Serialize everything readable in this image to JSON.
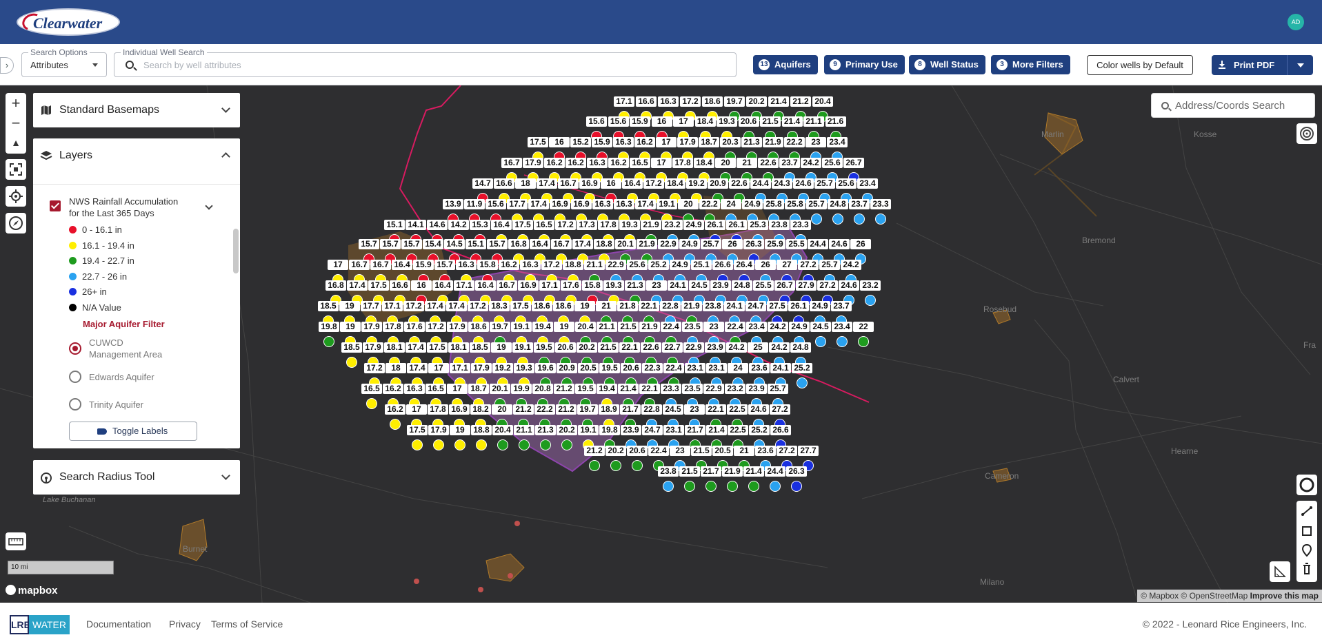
{
  "header": {
    "logo_text": "Clearwater",
    "avatar_initials": "AD"
  },
  "search": {
    "options_legend": "Search Options",
    "options_value": "Attributes",
    "well_legend": "Individual Well Search",
    "well_placeholder": "Search by well attributes"
  },
  "filters": [
    {
      "count": "13",
      "label": "Aquifers"
    },
    {
      "count": "9",
      "label": "Primary Use"
    },
    {
      "count": "8",
      "label": "Well Status"
    },
    {
      "count": "3",
      "label": "More Filters"
    }
  ],
  "actions": {
    "color_wells": "Color wells by Default",
    "print_pdf": "Print PDF"
  },
  "panel": {
    "basemaps_title": "Standard Basemaps",
    "layers_title": "Layers",
    "layer_name_line1": "NWS Rainfall Accumulation",
    "layer_name_line2": "for the Last 365 Days",
    "legend": [
      {
        "label": "0 - 16.1 in",
        "color": "#e8102a"
      },
      {
        "label": "16.1 - 19.4 in",
        "color": "#ffee00"
      },
      {
        "label": "19.4 - 22.7 in",
        "color": "#1e9b1e"
      },
      {
        "label": "22.7 - 26 in",
        "color": "#2aa2f0"
      },
      {
        "label": "26+ in",
        "color": "#1a30e0"
      },
      {
        "label": "N/A Value",
        "color": "#000000"
      }
    ],
    "aquifer_filter_title": "Major Aquifer Filter",
    "aquifers": [
      {
        "label_line1": "CUWCD",
        "label_line2": "Management Area",
        "selected": true
      },
      {
        "label_line1": "Edwards Aquifer",
        "label_line2": "",
        "selected": false
      },
      {
        "label_line1": "Trinity Aquifer",
        "label_line2": "",
        "selected": false
      }
    ],
    "toggle_labels": "Toggle Labels",
    "search_radius_title": "Search Radius Tool"
  },
  "map": {
    "address_placeholder": "Address/Coords Search",
    "scale_label": "10 mi",
    "towns": [
      "Marlin",
      "Kosse",
      "Bremond",
      "Rosebud",
      "Calvert",
      "Hearne",
      "Cameron",
      "Milano",
      "Burnet",
      "Fra"
    ],
    "lake_label": "Lake Buchanan",
    "mapbox_label": "mapbox",
    "attribution_text": "© Mapbox © OpenStreetMap",
    "attribution_link": "Improve this map",
    "wells": [
      [
        209,
        "17.1"
      ],
      [
        209,
        "16.6"
      ],
      [
        209,
        "16.3"
      ],
      [
        209,
        "17.2"
      ],
      [
        209,
        "18.6"
      ],
      [
        209,
        "19.7"
      ],
      [
        209,
        "20.2"
      ],
      [
        209,
        "21.4"
      ],
      [
        209,
        "21.2"
      ],
      [
        209,
        "20.4"
      ],
      [
        209,
        "15.6"
      ],
      [
        209,
        "15.6"
      ],
      [
        209,
        "15.9"
      ],
      [
        209,
        "16"
      ],
      [
        209,
        "17"
      ],
      [
        209,
        "18.4"
      ],
      [
        209,
        "19.3"
      ],
      [
        209,
        "20.6"
      ],
      [
        209,
        "21.5"
      ],
      [
        209,
        "21.4"
      ],
      [
        209,
        "21.1"
      ],
      [
        209,
        "21.6"
      ],
      [
        209,
        "17.5"
      ],
      [
        209,
        "16"
      ],
      [
        209,
        "15.2"
      ],
      [
        209,
        "15.9"
      ],
      [
        209,
        "16.3"
      ],
      [
        209,
        "16.2"
      ],
      [
        209,
        "17"
      ],
      [
        209,
        "17.9"
      ],
      [
        209,
        "18.7"
      ],
      [
        209,
        "20.3"
      ],
      [
        209,
        "21.3"
      ],
      [
        209,
        "21.9"
      ],
      [
        209,
        "22.2"
      ],
      [
        209,
        "23"
      ],
      [
        209,
        "23.4"
      ],
      [
        209,
        "16.7"
      ],
      [
        209,
        "17.9"
      ],
      [
        209,
        "16.2"
      ],
      [
        209,
        "16.2"
      ],
      [
        209,
        "16.3"
      ],
      [
        209,
        "16.2"
      ],
      [
        209,
        "16.5"
      ],
      [
        209,
        "17"
      ],
      [
        209,
        "17.8"
      ],
      [
        209,
        "18.4"
      ],
      [
        209,
        "20"
      ],
      [
        209,
        "21"
      ],
      [
        209,
        "22.6"
      ],
      [
        209,
        "23.7"
      ],
      [
        209,
        "24.2"
      ],
      [
        209,
        "25.6"
      ],
      [
        209,
        "26.7"
      ],
      [
        209,
        "14.7"
      ],
      [
        209,
        "16.6"
      ],
      [
        209,
        "18"
      ],
      [
        209,
        "17.4"
      ],
      [
        209,
        "16.7"
      ],
      [
        209,
        "16.9"
      ],
      [
        209,
        "16"
      ],
      [
        209,
        "16.4"
      ],
      [
        209,
        "17.2"
      ],
      [
        209,
        "18.4"
      ],
      [
        209,
        "19.2"
      ],
      [
        209,
        "20.9"
      ],
      [
        209,
        "22.6"
      ],
      [
        209,
        "24.4"
      ],
      [
        209,
        "24.3"
      ],
      [
        209,
        "24.6"
      ],
      [
        209,
        "25.7"
      ],
      [
        209,
        "25.6"
      ],
      [
        209,
        "23.4"
      ],
      [
        209,
        "13.9"
      ],
      [
        209,
        "11.9"
      ],
      [
        209,
        "15.6"
      ],
      [
        209,
        "17.7"
      ],
      [
        209,
        "17.4"
      ],
      [
        209,
        "16.9"
      ],
      [
        209,
        "16.9"
      ],
      [
        209,
        "16.3"
      ],
      [
        209,
        "16.3"
      ],
      [
        209,
        "17.4"
      ],
      [
        209,
        "19.1"
      ],
      [
        209,
        "20"
      ],
      [
        209,
        "22.2"
      ],
      [
        209,
        "24"
      ],
      [
        209,
        "24.9"
      ],
      [
        209,
        "25.8"
      ],
      [
        209,
        "25.8"
      ],
      [
        209,
        "25.7"
      ],
      [
        209,
        "24.8"
      ],
      [
        209,
        "23.7"
      ],
      [
        209,
        "23.3"
      ],
      [
        209,
        "15.1"
      ],
      [
        209,
        "14.1"
      ],
      [
        209,
        "14.6"
      ],
      [
        209,
        "14.2"
      ],
      [
        209,
        "15.3"
      ],
      [
        209,
        "16.4"
      ],
      [
        209,
        "17.5"
      ],
      [
        209,
        "16.5"
      ],
      [
        209,
        "17.2"
      ],
      [
        209,
        "17.3"
      ],
      [
        209,
        "17.8"
      ],
      [
        209,
        "19.3"
      ],
      [
        209,
        "21.9"
      ],
      [
        209,
        "23.2"
      ],
      [
        209,
        "24.9"
      ],
      [
        209,
        "26.1"
      ],
      [
        209,
        "26.1"
      ],
      [
        209,
        "25.3"
      ],
      [
        209,
        "23.8"
      ],
      [
        209,
        "23.3"
      ],
      [
        209,
        "15.7"
      ],
      [
        209,
        "15.7"
      ],
      [
        209,
        "15.7"
      ],
      [
        209,
        "15.4"
      ],
      [
        209,
        "14.5"
      ],
      [
        209,
        "15.1"
      ],
      [
        209,
        "15.7"
      ],
      [
        209,
        "16.8"
      ],
      [
        209,
        "16.4"
      ],
      [
        209,
        "16.7"
      ],
      [
        209,
        "17.4"
      ],
      [
        209,
        "18.8"
      ],
      [
        209,
        "20.1"
      ],
      [
        209,
        "21.9"
      ],
      [
        209,
        "22.9"
      ],
      [
        209,
        "24.9"
      ],
      [
        209,
        "25.7"
      ],
      [
        209,
        "26"
      ],
      [
        209,
        "26.3"
      ],
      [
        209,
        "25.9"
      ],
      [
        209,
        "25.5"
      ],
      [
        209,
        "24.4"
      ],
      [
        209,
        "24.6"
      ],
      [
        209,
        "26"
      ],
      [
        209,
        "17"
      ],
      [
        209,
        "16.7"
      ],
      [
        209,
        "16.7"
      ],
      [
        209,
        "16.4"
      ],
      [
        209,
        "15.9"
      ],
      [
        209,
        "15.7"
      ],
      [
        209,
        "16.3"
      ],
      [
        209,
        "15.8"
      ],
      [
        209,
        "16.2"
      ],
      [
        209,
        "16.3"
      ],
      [
        209,
        "17.2"
      ],
      [
        209,
        "18.8"
      ],
      [
        209,
        "21.1"
      ],
      [
        209,
        "22.9"
      ],
      [
        209,
        "25.6"
      ],
      [
        209,
        "25.2"
      ],
      [
        209,
        "24.9"
      ],
      [
        209,
        "25.1"
      ],
      [
        209,
        "26.6"
      ],
      [
        209,
        "26.4"
      ],
      [
        209,
        "26"
      ],
      [
        209,
        "27"
      ],
      [
        209,
        "27.2"
      ],
      [
        209,
        "25.7"
      ],
      [
        209,
        "24.2"
      ],
      [
        209,
        "16.8"
      ],
      [
        209,
        "17.4"
      ],
      [
        209,
        "17.5"
      ],
      [
        209,
        "16.6"
      ],
      [
        209,
        "16"
      ],
      [
        209,
        "16.4"
      ],
      [
        209,
        "17.1"
      ],
      [
        209,
        "16.4"
      ],
      [
        209,
        "16.7"
      ],
      [
        209,
        "16.9"
      ],
      [
        209,
        "17.1"
      ],
      [
        209,
        "17.6"
      ],
      [
        209,
        "15.8"
      ],
      [
        209,
        "19.3"
      ],
      [
        209,
        "21.3"
      ],
      [
        209,
        "23"
      ],
      [
        209,
        "24.1"
      ],
      [
        209,
        "24.5"
      ],
      [
        209,
        "23.9"
      ],
      [
        209,
        "24.8"
      ],
      [
        209,
        "25.5"
      ],
      [
        209,
        "26.7"
      ],
      [
        209,
        "27.9"
      ],
      [
        209,
        "27.2"
      ],
      [
        209,
        "24.6"
      ],
      [
        209,
        "23.2"
      ],
      [
        209,
        "18.5"
      ],
      [
        209,
        "19"
      ],
      [
        209,
        "17.7"
      ],
      [
        209,
        "17.1"
      ],
      [
        209,
        "17.2"
      ],
      [
        209,
        "17.4"
      ],
      [
        209,
        "17.4"
      ],
      [
        209,
        "17.2"
      ],
      [
        209,
        "18.3"
      ],
      [
        209,
        "17.5"
      ],
      [
        209,
        "18.6"
      ],
      [
        209,
        "18.6"
      ],
      [
        209,
        "19"
      ],
      [
        209,
        "21"
      ],
      [
        209,
        "21.8"
      ],
      [
        209,
        "22.1"
      ],
      [
        209,
        "22.8"
      ],
      [
        209,
        "21.9"
      ],
      [
        209,
        "23.8"
      ],
      [
        209,
        "24.1"
      ],
      [
        209,
        "24.7"
      ],
      [
        209,
        "27.5"
      ],
      [
        209,
        "26.1"
      ],
      [
        209,
        "24.9"
      ],
      [
        209,
        "23.7"
      ],
      [
        209,
        "19.8"
      ],
      [
        209,
        "19"
      ],
      [
        209,
        "17.9"
      ],
      [
        209,
        "17.8"
      ],
      [
        209,
        "17.6"
      ],
      [
        209,
        "17.2"
      ],
      [
        209,
        "17.9"
      ],
      [
        209,
        "18.6"
      ],
      [
        209,
        "19.7"
      ],
      [
        209,
        "19.1"
      ],
      [
        209,
        "19.4"
      ],
      [
        209,
        "19"
      ],
      [
        209,
        "20.4"
      ],
      [
        209,
        "21.1"
      ],
      [
        209,
        "21.5"
      ],
      [
        209,
        "21.9"
      ],
      [
        209,
        "22.4"
      ],
      [
        209,
        "23.5"
      ],
      [
        209,
        "23"
      ],
      [
        209,
        "22.4"
      ],
      [
        209,
        "23.4"
      ],
      [
        209,
        "24.2"
      ],
      [
        209,
        "24.9"
      ],
      [
        209,
        "24.5"
      ],
      [
        209,
        "23.4"
      ],
      [
        209,
        "22"
      ],
      [
        209,
        "18.5"
      ],
      [
        209,
        "17.9"
      ],
      [
        209,
        "18.1"
      ],
      [
        209,
        "17.4"
      ],
      [
        209,
        "17.5"
      ],
      [
        209,
        "18.1"
      ],
      [
        209,
        "18.5"
      ],
      [
        209,
        "19"
      ],
      [
        209,
        "19.1"
      ],
      [
        209,
        "19.5"
      ],
      [
        209,
        "20.6"
      ],
      [
        209,
        "20.2"
      ],
      [
        209,
        "21.5"
      ],
      [
        209,
        "22.1"
      ],
      [
        209,
        "22.6"
      ],
      [
        209,
        "22.7"
      ],
      [
        209,
        "22.9"
      ],
      [
        209,
        "23.9"
      ],
      [
        209,
        "24.2"
      ],
      [
        209,
        "25"
      ],
      [
        209,
        "24.2"
      ],
      [
        209,
        "24.8"
      ],
      [
        209,
        "17.2"
      ],
      [
        209,
        "18"
      ],
      [
        209,
        "17.4"
      ],
      [
        209,
        "17"
      ],
      [
        209,
        "17.1"
      ],
      [
        209,
        "17.9"
      ],
      [
        209,
        "19.2"
      ],
      [
        209,
        "19.3"
      ],
      [
        209,
        "19.6"
      ],
      [
        209,
        "20.9"
      ],
      [
        209,
        "20.5"
      ],
      [
        209,
        "19.5"
      ],
      [
        209,
        "20.6"
      ],
      [
        209,
        "22.3"
      ],
      [
        209,
        "22.4"
      ],
      [
        209,
        "23.1"
      ],
      [
        209,
        "23.1"
      ],
      [
        209,
        "24"
      ],
      [
        209,
        "23.6"
      ],
      [
        209,
        "24.1"
      ],
      [
        209,
        "25.2"
      ],
      [
        209,
        "16.5"
      ],
      [
        209,
        "16.2"
      ],
      [
        209,
        "16.3"
      ],
      [
        209,
        "16.5"
      ],
      [
        209,
        "17"
      ],
      [
        209,
        "18.7"
      ],
      [
        209,
        "20.1"
      ],
      [
        209,
        "19.9"
      ],
      [
        209,
        "20.8"
      ],
      [
        209,
        "21.2"
      ],
      [
        209,
        "19.5"
      ],
      [
        209,
        "19.4"
      ],
      [
        209,
        "21.4"
      ],
      [
        209,
        "22.1"
      ],
      [
        209,
        "23.3"
      ],
      [
        209,
        "23.5"
      ],
      [
        209,
        "22.9"
      ],
      [
        209,
        "23.2"
      ],
      [
        209,
        "23.9"
      ],
      [
        209,
        "25.7"
      ],
      [
        209,
        "16.2"
      ],
      [
        209,
        "17"
      ],
      [
        209,
        "17.8"
      ],
      [
        209,
        "16.9"
      ],
      [
        209,
        "18.2"
      ],
      [
        209,
        "20"
      ],
      [
        209,
        "21.2"
      ],
      [
        209,
        "22.2"
      ],
      [
        209,
        "21.2"
      ],
      [
        209,
        "19.7"
      ],
      [
        209,
        "18.9"
      ],
      [
        209,
        "21.7"
      ],
      [
        209,
        "22.8"
      ],
      [
        209,
        "24.5"
      ],
      [
        209,
        "23"
      ],
      [
        209,
        "22.1"
      ],
      [
        209,
        "22.5"
      ],
      [
        209,
        "24.6"
      ],
      [
        209,
        "27.2"
      ],
      [
        209,
        "17.5"
      ],
      [
        209,
        "17.9"
      ],
      [
        209,
        "19"
      ],
      [
        209,
        "18.8"
      ],
      [
        209,
        "20.4"
      ],
      [
        209,
        "21.1"
      ],
      [
        209,
        "21.3"
      ],
      [
        209,
        "20.2"
      ],
      [
        209,
        "19.1"
      ],
      [
        209,
        "19.8"
      ],
      [
        209,
        "23.9"
      ],
      [
        209,
        "24.7"
      ],
      [
        209,
        "23.1"
      ],
      [
        209,
        "21.7"
      ],
      [
        209,
        "21.4"
      ],
      [
        209,
        "22.5"
      ],
      [
        209,
        "25.2"
      ],
      [
        209,
        "26.6"
      ],
      [
        209,
        "21.2"
      ],
      [
        209,
        "20.2"
      ],
      [
        209,
        "20.6"
      ],
      [
        209,
        "22.4"
      ],
      [
        209,
        "23"
      ],
      [
        209,
        "21.5"
      ],
      [
        209,
        "20.5"
      ],
      [
        209,
        "21"
      ],
      [
        209,
        "23.6"
      ],
      [
        209,
        "27.2"
      ],
      [
        209,
        "27.7"
      ],
      [
        209,
        "23.8"
      ],
      [
        209,
        "21.5"
      ],
      [
        209,
        "21.7"
      ],
      [
        209,
        "21.9"
      ],
      [
        209,
        "21.4"
      ],
      [
        209,
        "24.4"
      ],
      [
        209,
        "26.3"
      ]
    ]
  },
  "footer": {
    "logo_left": "LRE",
    "logo_right": "WATER",
    "links": [
      "Documentation",
      "Privacy",
      "Terms of Service"
    ],
    "copyright": "© 2022 - Leonard Rice Engineers, Inc."
  }
}
